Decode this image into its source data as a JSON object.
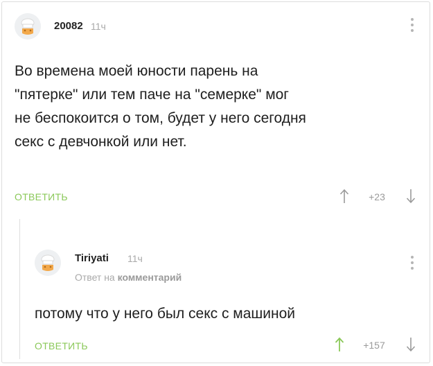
{
  "comment1": {
    "username": "20082",
    "time": "11ч",
    "text": "Во времена моей юности парень на\n\"пятерке\" или тем паче на \"семерке\" мог\nне беспокоится о том, будет у него сегодня\nсекс с девчонкой или нет.",
    "reply_label": "ОТВЕТИТЬ",
    "rating": "+23",
    "vote_up_icon": "arrow-up-icon",
    "vote_down_icon": "arrow-down-icon",
    "menu_icon": "more-vertical-icon"
  },
  "comment2": {
    "username": "Tiriyati",
    "time": "11ч",
    "reply_to_prefix": "Ответ на",
    "reply_to_link": "комментарий",
    "text": "потому что у него был секс с машиной",
    "reply_label": "ОТВЕТИТЬ",
    "rating": "+157",
    "vote_up_icon": "arrow-up-icon",
    "vote_down_icon": "arrow-down-icon",
    "menu_icon": "more-vertical-icon"
  },
  "colors": {
    "accent_green": "#8ac858",
    "muted_gray": "#a9a9a9",
    "text": "#1e1e1e"
  }
}
